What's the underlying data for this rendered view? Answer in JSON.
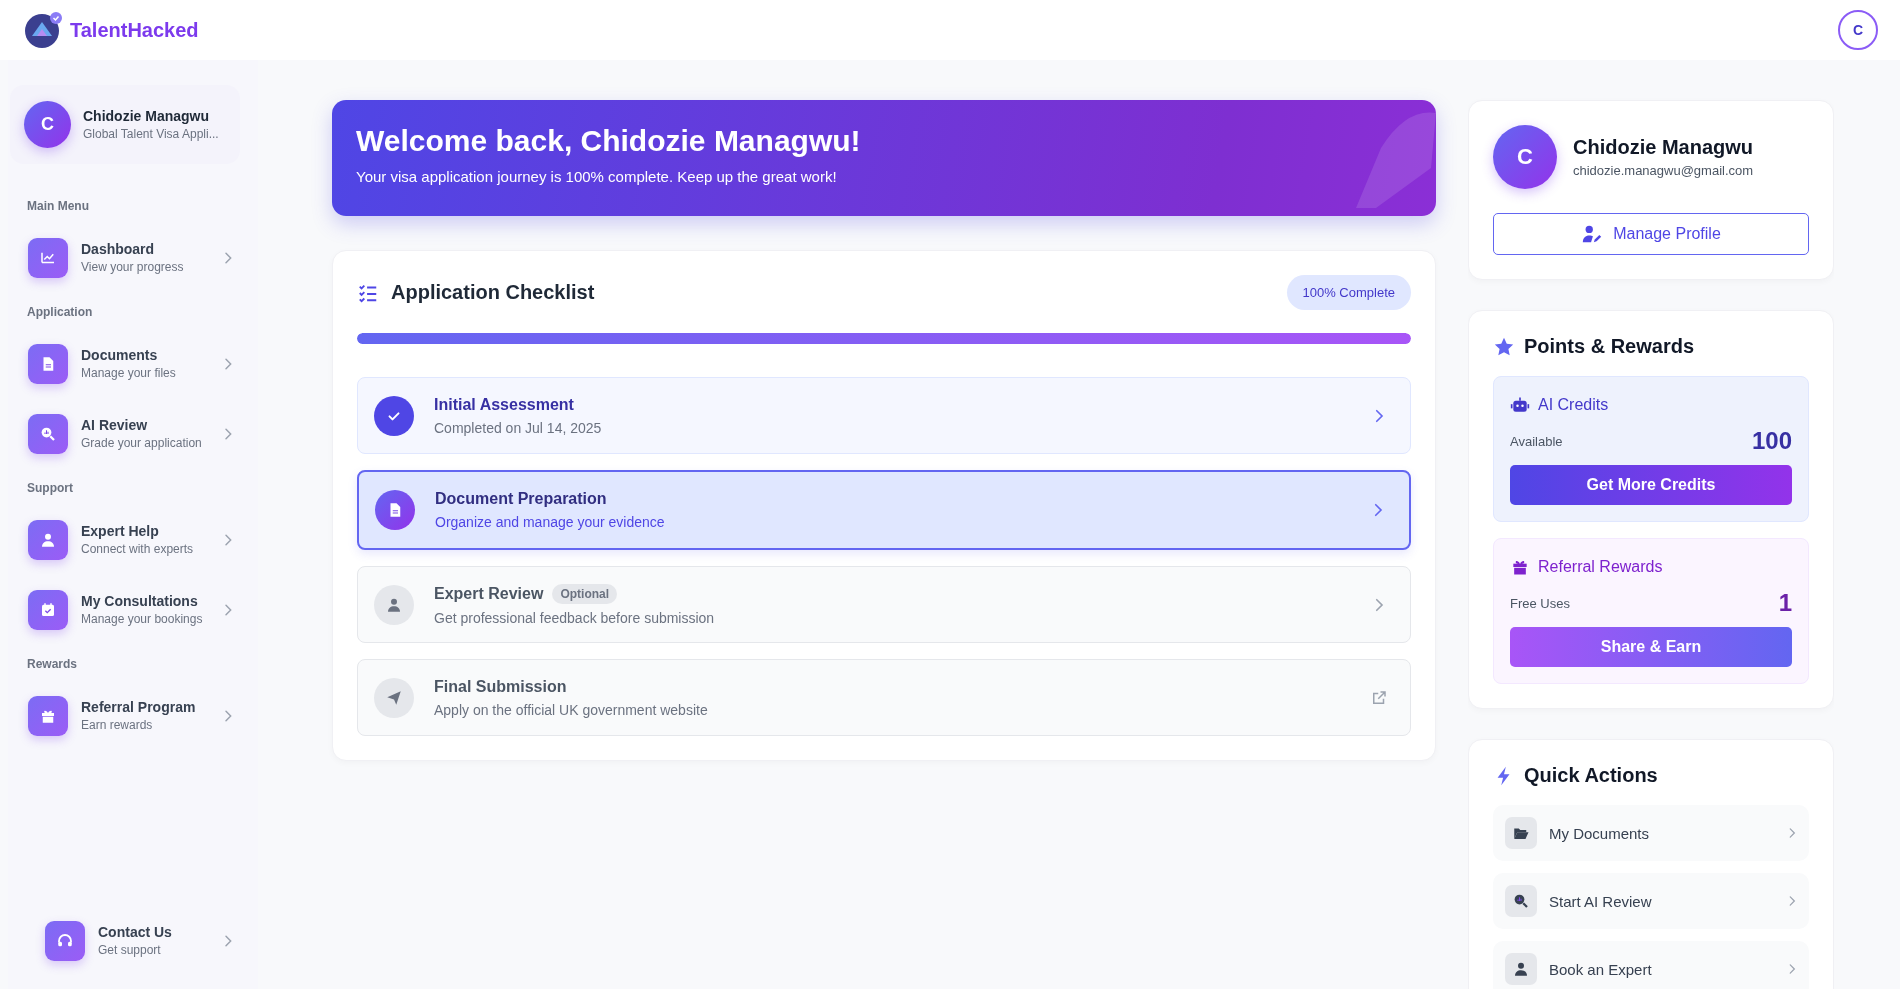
{
  "header": {
    "brand": "TalentHacked",
    "avatar_initial": "C"
  },
  "sidebar": {
    "profile": {
      "initial": "C",
      "name": "Chidozie Managwu",
      "subtitle": "Global Talent Visa Appli..."
    },
    "sections": [
      {
        "label": "Main Menu",
        "items": [
          {
            "title": "Dashboard",
            "subtitle": "View your progress"
          }
        ]
      },
      {
        "label": "Application",
        "items": [
          {
            "title": "Documents",
            "subtitle": "Manage your files"
          },
          {
            "title": "AI Review",
            "subtitle": "Grade your application"
          }
        ]
      },
      {
        "label": "Support",
        "items": [
          {
            "title": "Expert Help",
            "subtitle": "Connect with experts"
          },
          {
            "title": "My Consultations",
            "subtitle": "Manage your bookings"
          }
        ]
      },
      {
        "label": "Rewards",
        "items": [
          {
            "title": "Referral Program",
            "subtitle": "Earn rewards"
          }
        ]
      }
    ],
    "footer_item": {
      "title": "Contact Us",
      "subtitle": "Get support"
    }
  },
  "banner": {
    "title": "Welcome back, Chidozie Managwu!",
    "subtitle": "Your visa application journey is 100% complete. Keep up the great work!"
  },
  "checklist": {
    "title": "Application Checklist",
    "badge": "100% Complete",
    "level": 1,
    "items": [
      {
        "kind": "step",
        "completed": true,
        "selected": false,
        "title": "Initial Assessment",
        "subtitle": "Completed on Jul 14, 2025"
      },
      {
        "kind": "step",
        "completed": false,
        "selected": true,
        "title": "Document Preparation",
        "subtitle": "Organize and manage your evidence"
      },
      {
        "kind": "step",
        "completed": false,
        "selected": false,
        "title": "Expert Review",
        "tag": "Optional",
        "subtitle": "Get professional feedback before submission"
      },
      {
        "kind": "external",
        "completed": false,
        "selected": false,
        "title": "Final Submission",
        "subtitle": "Apply on the official UK government website"
      }
    ]
  },
  "profile_card": {
    "initial": "C",
    "name": "Chidozie Managwu",
    "email": "chidozie.managwu@gmail.com",
    "button": "Manage Profile"
  },
  "rewards": {
    "title": "Points & Rewards",
    "blocks": [
      {
        "kind": "credits",
        "title": "AI Credits",
        "label": "Available",
        "value": "100",
        "button": "Get More Credits"
      },
      {
        "kind": "referral",
        "title": "Referral Rewards",
        "label": "Free Uses",
        "value": "1",
        "button": "Share & Earn"
      }
    ]
  },
  "quick_actions": {
    "title": "Quick Actions",
    "items": [
      {
        "label": "My Documents"
      },
      {
        "label": "Start AI Review"
      },
      {
        "label": "Book an Expert"
      }
    ]
  }
}
